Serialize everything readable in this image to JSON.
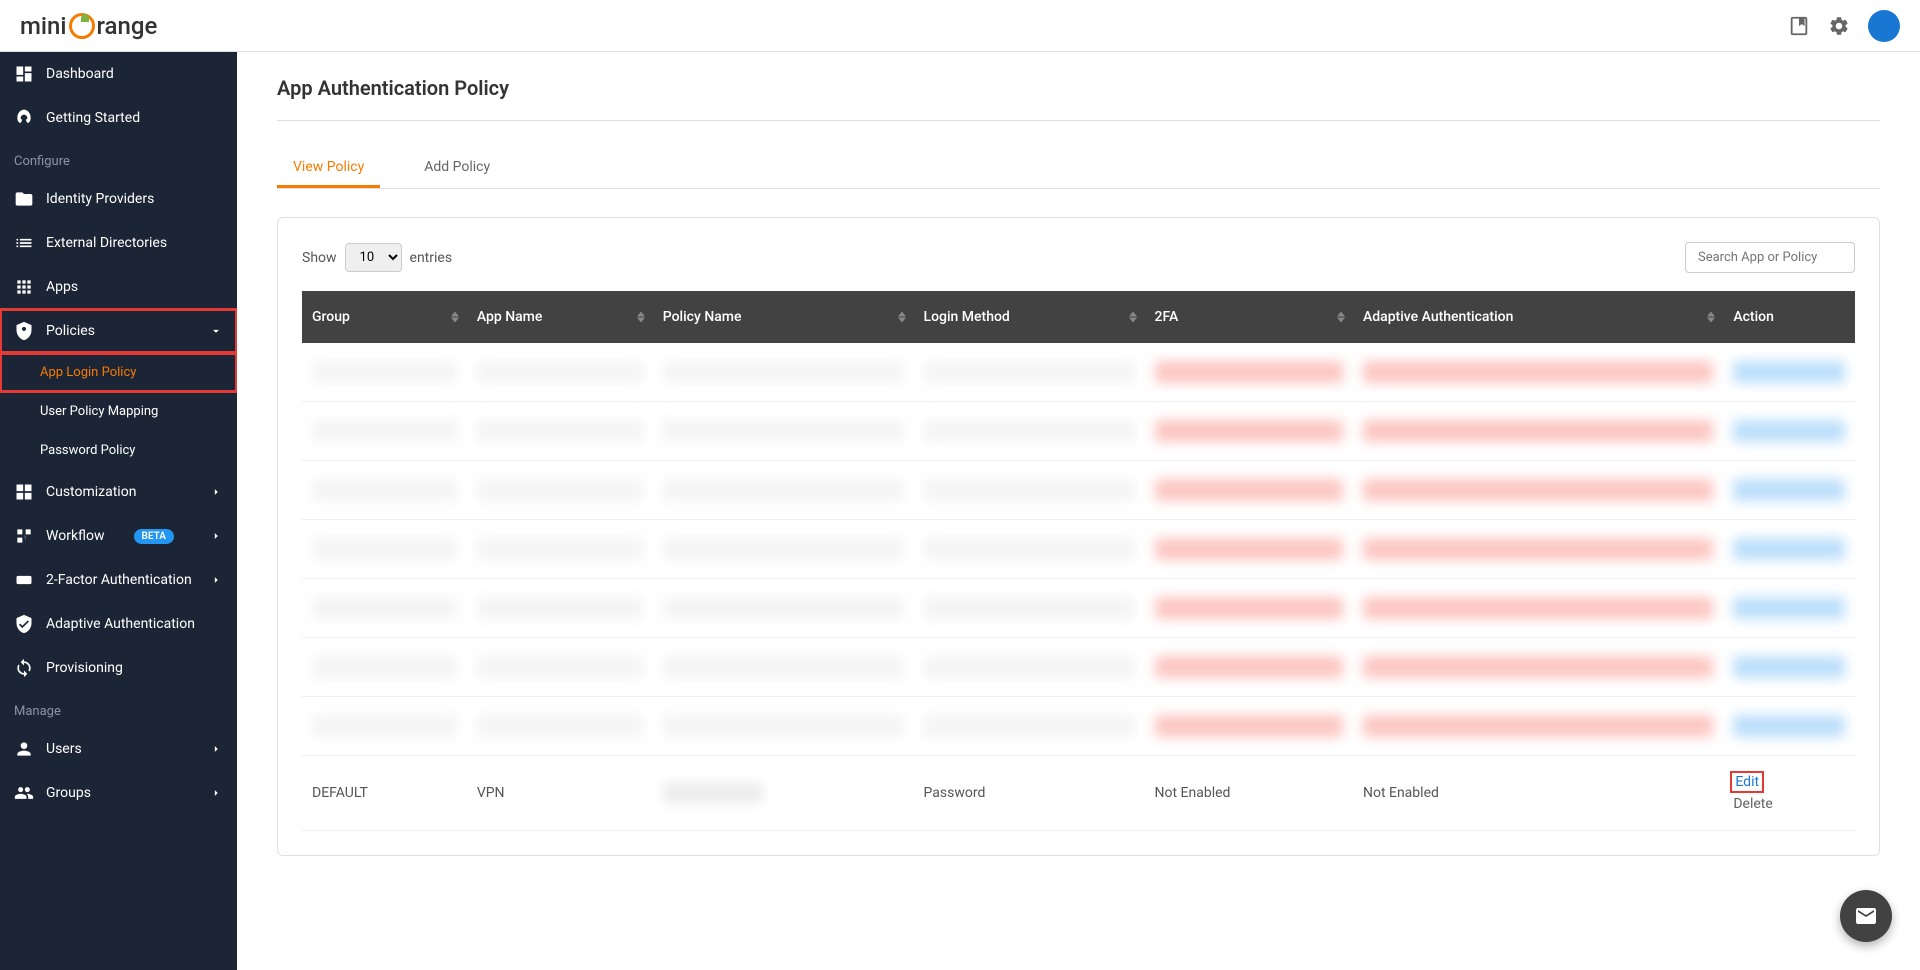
{
  "brand": {
    "name": "miniOrange"
  },
  "header": {
    "book_icon": "book",
    "gear_icon": "settings"
  },
  "sidebar": {
    "items": [
      {
        "icon": "dashboard",
        "label": "Dashboard"
      },
      {
        "icon": "rocket",
        "label": "Getting Started"
      }
    ],
    "section_configure": "Configure",
    "configure_items": [
      {
        "icon": "idp",
        "label": "Identity Providers"
      },
      {
        "icon": "list",
        "label": "External Directories"
      },
      {
        "icon": "apps",
        "label": "Apps"
      },
      {
        "icon": "shield",
        "label": "Policies",
        "expanded": true
      },
      {
        "icon": "",
        "label": "App Login Policy",
        "sub": true,
        "active": true
      },
      {
        "icon": "",
        "label": "User Policy Mapping",
        "sub": true
      },
      {
        "icon": "",
        "label": "Password Policy",
        "sub": true
      },
      {
        "icon": "custom",
        "label": "Customization"
      },
      {
        "icon": "workflow",
        "label": "Workflow",
        "beta": true
      },
      {
        "icon": "2fa",
        "label": "2-Factor Authentication"
      },
      {
        "icon": "adaptive",
        "label": "Adaptive Authentication"
      },
      {
        "icon": "sync",
        "label": "Provisioning"
      }
    ],
    "section_manage": "Manage",
    "manage_items": [
      {
        "icon": "user",
        "label": "Users"
      },
      {
        "icon": "groups",
        "label": "Groups"
      }
    ],
    "beta_label": "BETA"
  },
  "content": {
    "title": "App Authentication Policy",
    "tabs": [
      {
        "label": "View Policy",
        "active": true
      },
      {
        "label": "Add Policy"
      }
    ],
    "table": {
      "show_label": "Show",
      "entries_label": "entries",
      "entries_value": "10",
      "search_placeholder": "Search App or Policy",
      "columns": [
        "Group",
        "App Name",
        "Policy Name",
        "Login Method",
        "2FA",
        "Adaptive Authentication",
        "Action"
      ],
      "visible_row": {
        "group": "DEFAULT",
        "app_name": "VPN",
        "policy_name": "",
        "login_method": "Password",
        "tfa": "Not Enabled",
        "adaptive": "Not Enabled",
        "edit": "Edit",
        "delete": "Delete"
      }
    }
  }
}
